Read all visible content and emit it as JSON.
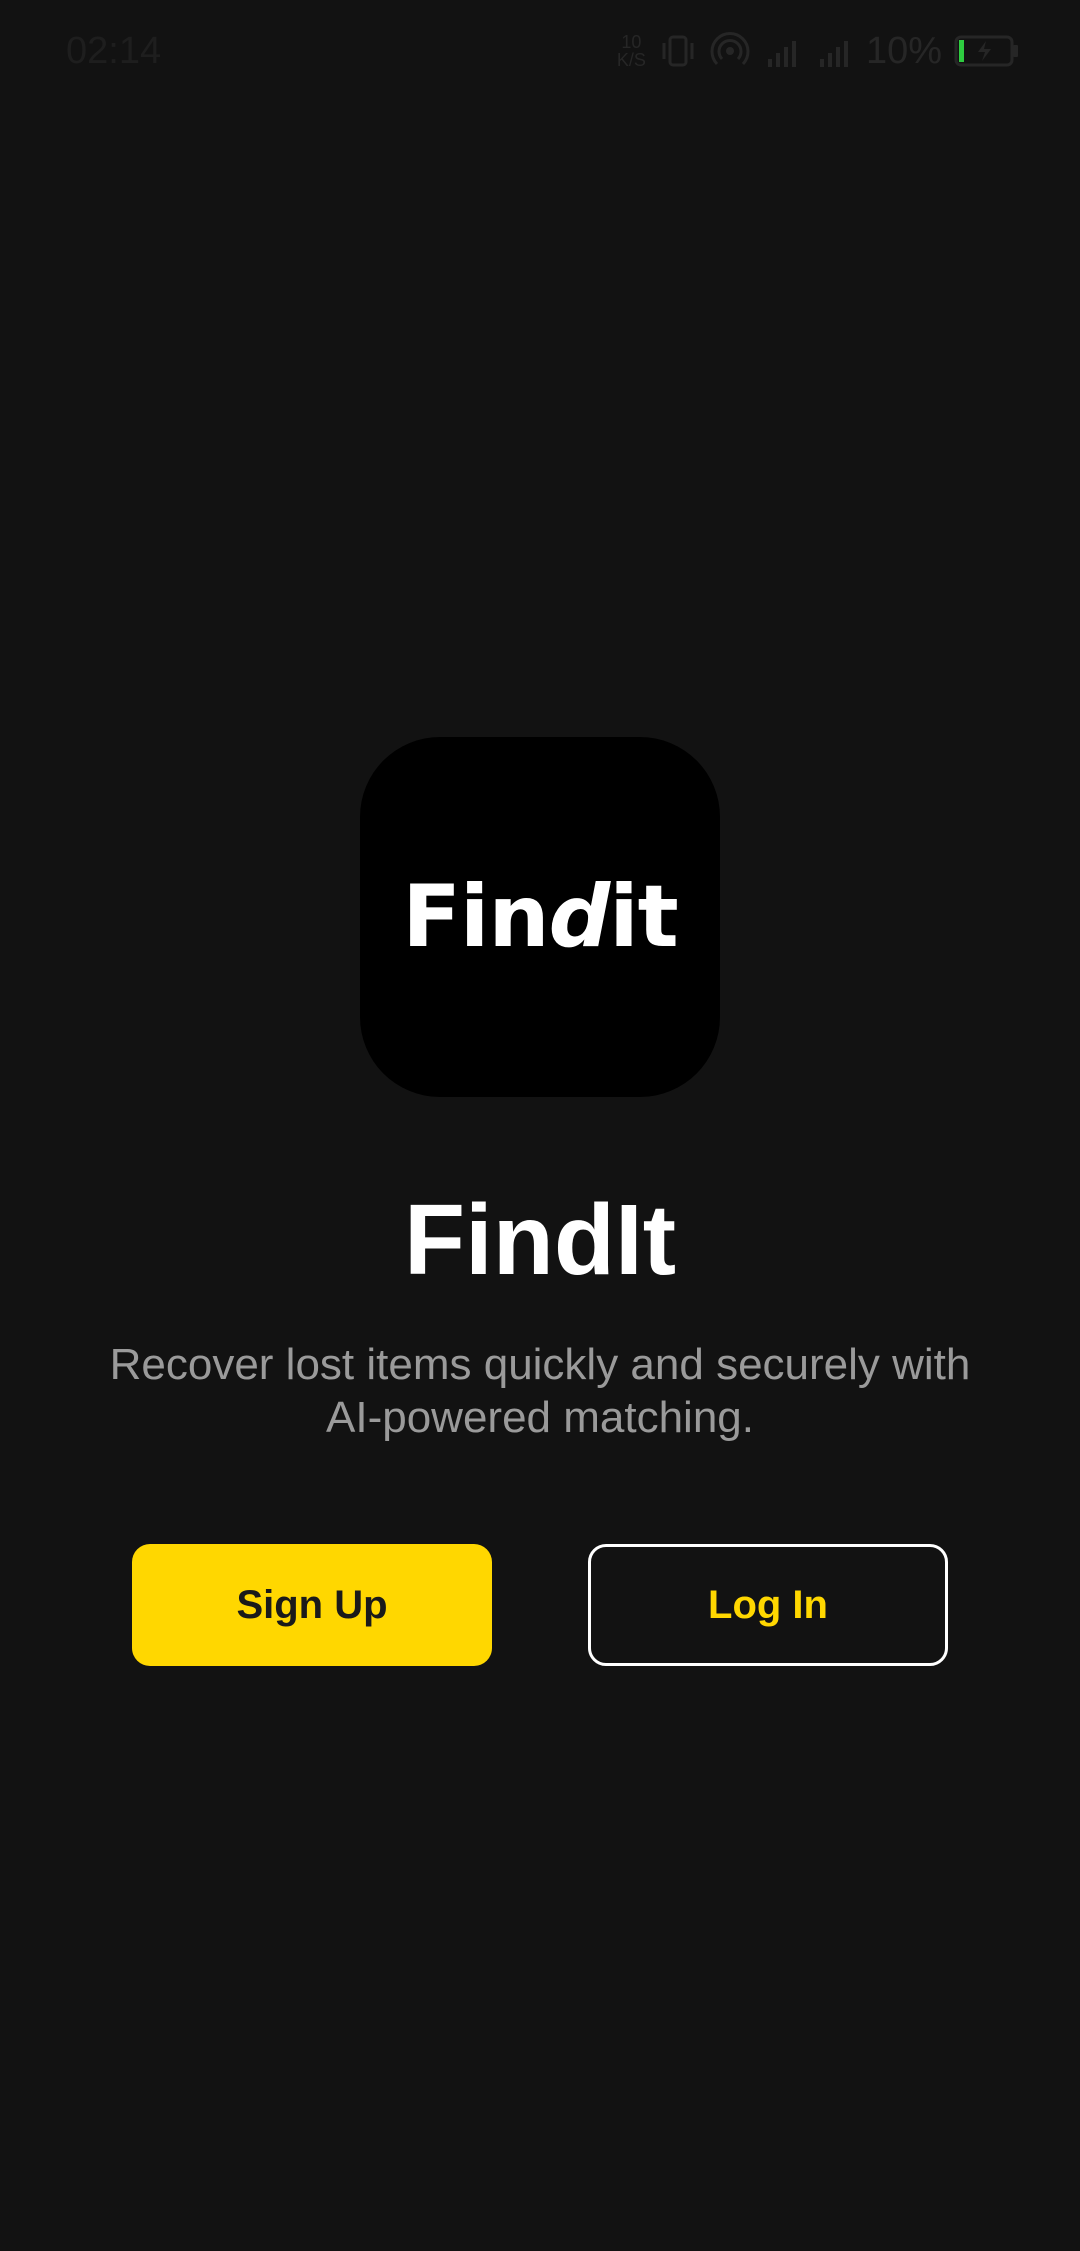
{
  "status_bar": {
    "time": "02:14",
    "net_speed_value": "10",
    "net_speed_unit": "K/S",
    "battery_percent": "10%",
    "icons": [
      "vibrate-icon",
      "hotspot-icon",
      "signal-4g-icon",
      "signal-icon",
      "battery-charging-icon"
    ]
  },
  "logo": {
    "text_part1": "Fin",
    "text_part2": "d",
    "text_part3": "it"
  },
  "app": {
    "title": "FindIt",
    "tagline": "Recover lost items quickly and securely with AI-powered matching."
  },
  "buttons": {
    "signup_label": "Sign Up",
    "login_label": "Log In"
  },
  "colors": {
    "background": "#121212",
    "accent": "#FFD700",
    "title": "#ffffff",
    "tagline": "#9a9a9a",
    "battery_level": "#2ecc40"
  }
}
